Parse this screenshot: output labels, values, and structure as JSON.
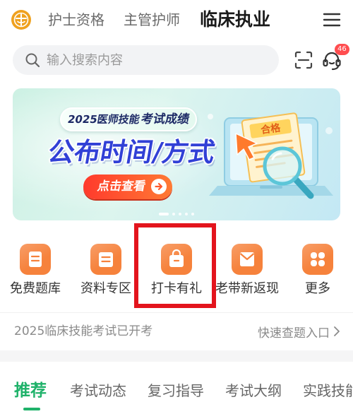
{
  "header": {
    "logo_icon": "logo-icon",
    "tabs": [
      {
        "label": "护士资格",
        "active": false
      },
      {
        "label": "主管护师",
        "active": false
      },
      {
        "label": "临床执业",
        "active": true
      }
    ],
    "menu_icon": "hamburger-menu-icon"
  },
  "search": {
    "icon": "search-icon",
    "placeholder": "输入搜索内容"
  },
  "toolbar": {
    "scan_icon": "scan-icon",
    "service_icon": "headset-icon",
    "service_badge": "46"
  },
  "banner": {
    "tag_prefix": "2025医师技能",
    "tag_emphasis": "考试成绩",
    "headline": "公布时间/方式",
    "cta_label": "点击查看",
    "cta_icon": "arrow-right-circle-icon",
    "document_stamp": "合格",
    "slide_count": 5,
    "active_slide": 1
  },
  "quick_entries": [
    {
      "label": "免费题库",
      "icon": "question-bank-icon",
      "highlighted": false
    },
    {
      "label": "资料专区",
      "icon": "materials-icon",
      "highlighted": false
    },
    {
      "label": "打卡有礼",
      "icon": "gift-bag-icon",
      "highlighted": true
    },
    {
      "label": "老带新返现",
      "icon": "envelope-icon",
      "highlighted": false
    },
    {
      "label": "更多",
      "icon": "more-grid-icon",
      "highlighted": false
    }
  ],
  "notice": {
    "text": "2025临床技能考试已开考",
    "link_label": "快速查题入口",
    "link_icon": "chevron-right-icon"
  },
  "feed_tabs": [
    {
      "label": "推荐",
      "active": true
    },
    {
      "label": "考试动态",
      "active": false
    },
    {
      "label": "复习指导",
      "active": false
    },
    {
      "label": "考试大纲",
      "active": false
    },
    {
      "label": "实践技能",
      "active": false
    }
  ],
  "theme": {
    "accent": "#f6823c",
    "logo": "#efa11f",
    "badge": "#ff4d4f",
    "active_tab": "#1fb26a",
    "highlight_border": "#e3141d"
  }
}
